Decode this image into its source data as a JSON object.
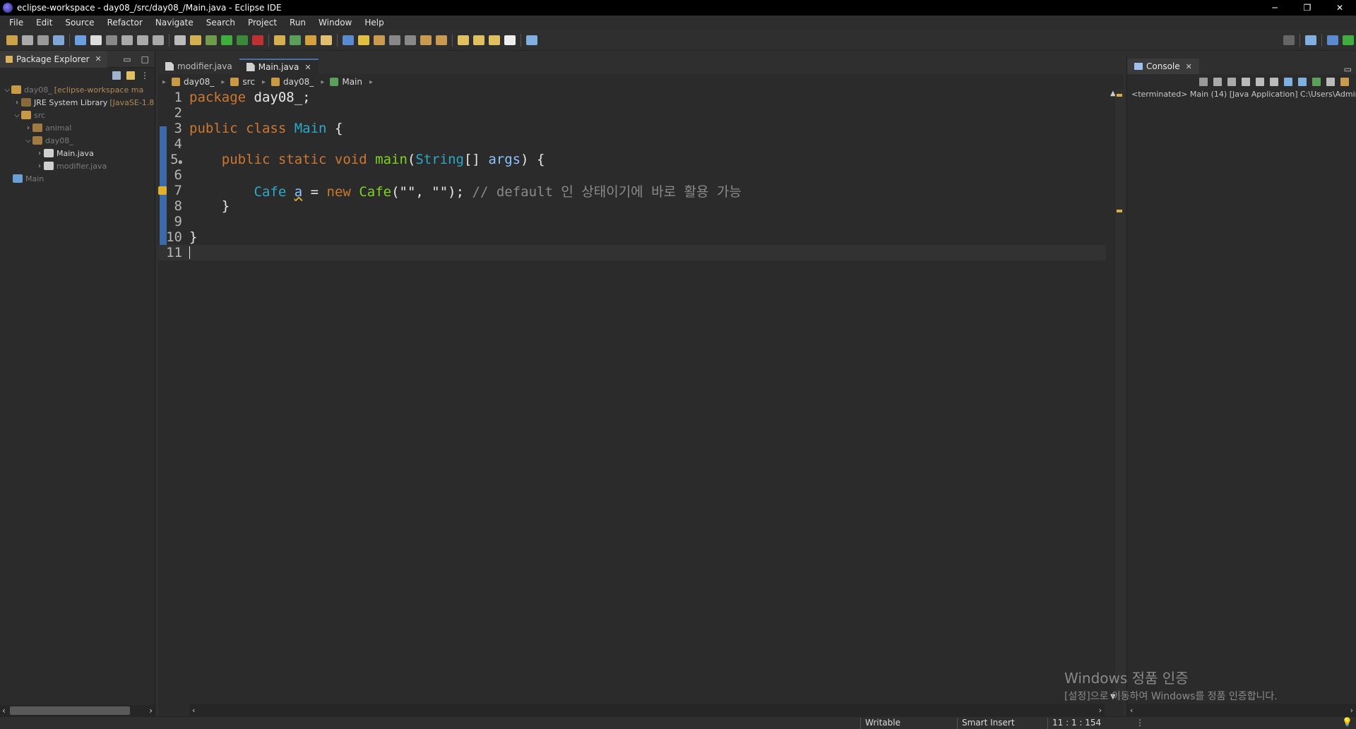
{
  "window": {
    "title": "eclipse-workspace - day08_/src/day08_/Main.java - Eclipse IDE",
    "controls": {
      "minimize": "─",
      "restore": "❐",
      "close": "✕"
    }
  },
  "menu": [
    "File",
    "Edit",
    "Source",
    "Refactor",
    "Navigate",
    "Search",
    "Project",
    "Run",
    "Window",
    "Help"
  ],
  "package_explorer": {
    "tab_label": "Package Explorer",
    "tree": {
      "project": {
        "name": "day08_",
        "decor": "[eclipse-workspace ma"
      },
      "jre": {
        "name": "JRE System Library",
        "decor": "[JavaSE-1.8"
      },
      "src": "src",
      "pkg_animal": "animal",
      "pkg_day08": "day08_",
      "file_main": "Main.java",
      "file_modifier": "modifier.java",
      "launch": "Main"
    }
  },
  "editor": {
    "tabs": [
      {
        "label": "modifier.java",
        "active": false
      },
      {
        "label": "Main.java",
        "active": true
      }
    ],
    "breadcrumb": [
      "day08_",
      "src",
      "day08_",
      "Main"
    ],
    "line_numbers": [
      "1",
      "2",
      "3",
      "4",
      "5",
      "6",
      "7",
      "8",
      "9",
      "10",
      "11"
    ],
    "line5_marker": "●",
    "code": {
      "l1_kw": "package",
      "l1_rest": "day08_;",
      "l3_kw": "public class",
      "l3_type": "Main",
      "l3_rest": "{",
      "l5_kw": "public static void",
      "l5_method": "main",
      "l5_paren": "(",
      "l5_type": "String",
      "l5_arr": "[]",
      "l5_var": "args",
      "l5_rest": ") {",
      "l7_type": "Cafe",
      "l7_var": "a",
      "l7_eq": "=",
      "l7_kw": "new",
      "l7_method": "Cafe",
      "l7_args": "(\"\", \"\");",
      "l7_comment": "// default 인 상태이기에 바로 활용 가능",
      "l8": "}",
      "l10": "}"
    }
  },
  "console": {
    "tab_label": "Console",
    "status": "<terminated> Main (14) [Java Application] C:\\Users\\Admin"
  },
  "watermark": {
    "line1": "Windows 정품 인증",
    "line2": "[설정]으로 이동하여 Windows를 정품 인증합니다."
  },
  "statusbar": {
    "writable": "Writable",
    "insert_mode": "Smart Insert",
    "position": "11 : 1 : 154"
  },
  "colors": {
    "keyword": "#cc7832",
    "type": "#2ea8c8",
    "method": "#7ed321",
    "variable": "#8ec3ff",
    "comment": "#8a8a8a"
  }
}
